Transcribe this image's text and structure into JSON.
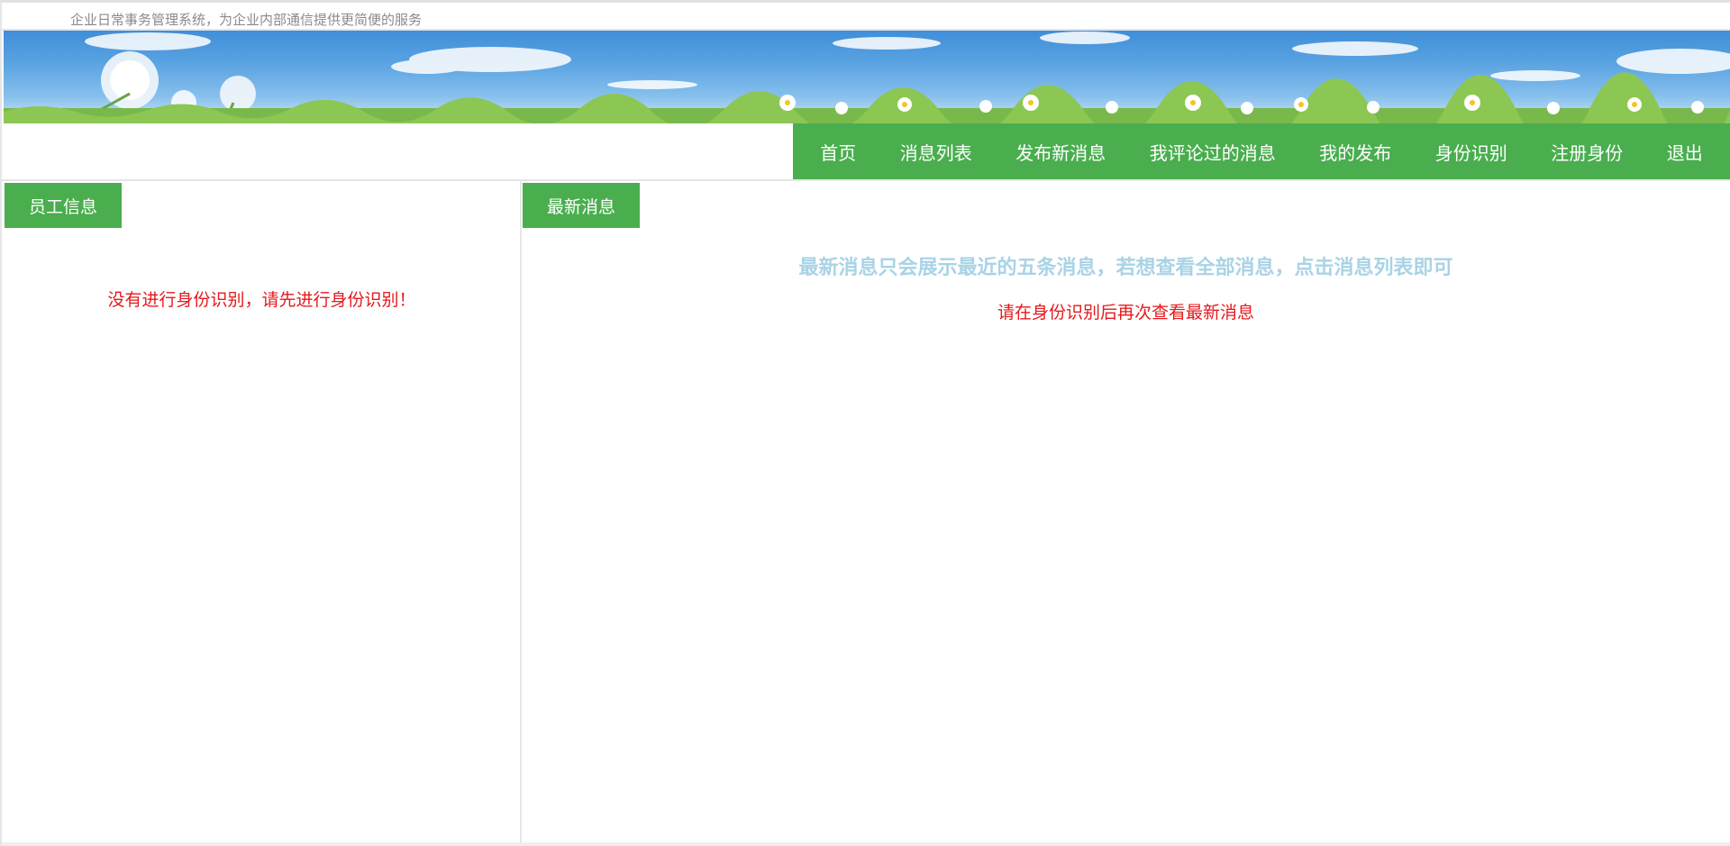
{
  "header": {
    "tagline": "企业日常事务管理系统，为企业内部通信提供更简便的服务"
  },
  "nav": {
    "items": [
      {
        "label": "首页"
      },
      {
        "label": "消息列表"
      },
      {
        "label": "发布新消息"
      },
      {
        "label": "我评论过的消息"
      },
      {
        "label": "我的发布"
      },
      {
        "label": "身份识别"
      },
      {
        "label": "注册身份"
      },
      {
        "label": "退出"
      }
    ]
  },
  "left_panel": {
    "tab_label": "员工信息",
    "warning": "没有进行身份识别，请先进行身份识别！"
  },
  "right_panel": {
    "tab_label": "最新消息",
    "notice": "最新消息只会展示最近的五条消息，若想查看全部消息，点击消息列表即可",
    "warning": "请在身份识别后再次查看最新消息"
  },
  "colors": {
    "accent_green": "#4aae4f",
    "warning_red": "#e5191c",
    "notice_blue": "#a9d3e6"
  }
}
